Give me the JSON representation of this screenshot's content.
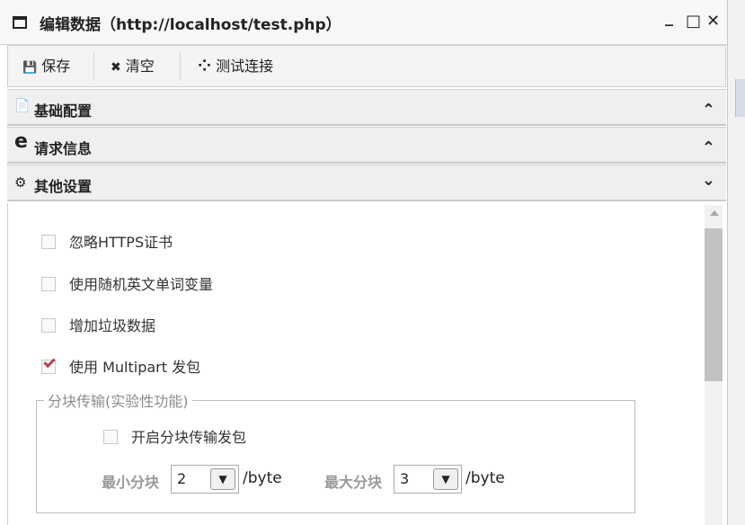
{
  "window": {
    "title": "编辑数据（http://localhost/test.php）",
    "icon": "window-icon",
    "controls": {
      "minimize": "_",
      "maximize": "□",
      "close": "✕"
    }
  },
  "toolbar": {
    "save_icon": "💾",
    "save_label": "保存",
    "clear_icon": "✖",
    "clear_label": "清空",
    "test_icon": "⁘",
    "test_label": "测试连接"
  },
  "panels": [
    {
      "icon": "📄",
      "label": "基础配置",
      "state": "collapsed",
      "chev": "⌃"
    },
    {
      "icon": "e",
      "label": "请求信息",
      "state": "collapsed",
      "chev": "⌃"
    },
    {
      "icon": "⚙",
      "label": "其他设置",
      "state": "expanded",
      "chev": "⌄"
    }
  ],
  "options": [
    {
      "label": "忽略HTTPS证书",
      "checked": false
    },
    {
      "label": "使用随机英文单词变量",
      "checked": false
    },
    {
      "label": "增加垃圾数据",
      "checked": false
    },
    {
      "label": "使用 Multipart 发包",
      "checked": true
    }
  ],
  "chunk": {
    "legend": "分块传输(实验性功能)",
    "enable_label": "开启分块传输发包",
    "enable_checked": false,
    "min_label": "最小分块",
    "min_value": "2",
    "max_label": "最大分块",
    "max_value": "3",
    "unit": "/byte"
  }
}
